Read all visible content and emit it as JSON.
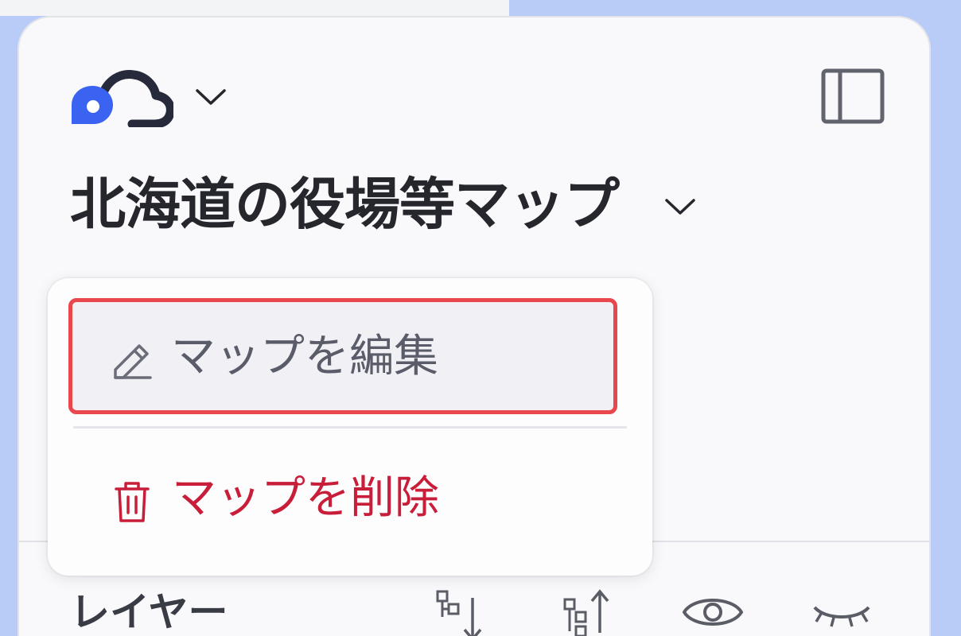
{
  "app": {
    "logo_icon": "cloud-pin-logo-icon",
    "account_chevron_icon": "chevron-down-icon",
    "sidebar_toggle_icon": "sidebar-toggle-icon"
  },
  "map": {
    "title": "北海道の役場等マップ",
    "title_chevron_icon": "chevron-down-icon"
  },
  "menu": {
    "items": [
      {
        "label": "マップを編集",
        "icon": "pencil-icon",
        "highlighted": true,
        "color": "#5a5c6a"
      },
      {
        "label": "マップを削除",
        "icon": "trash-icon",
        "color": "#c81e39"
      }
    ],
    "highlight_border_color": "#e8474c"
  },
  "layers": {
    "label": "レイヤー",
    "tools": [
      {
        "icon": "sort-down-icon"
      },
      {
        "icon": "sort-up-icon"
      },
      {
        "icon": "eye-icon"
      },
      {
        "icon": "eye-closed-icon"
      }
    ]
  },
  "colors": {
    "map_water": "#b9ccf8",
    "panel_bg": "#f9f9fc",
    "logo_accent": "#3b63f2",
    "logo_dark": "#262a3a"
  }
}
